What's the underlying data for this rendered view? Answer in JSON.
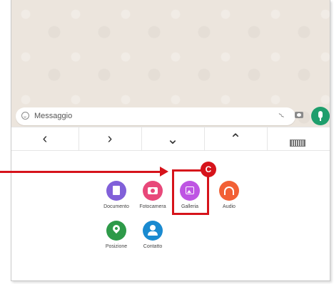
{
  "message_bar": {
    "placeholder": "Messaggio"
  },
  "keys": [
    "‹",
    "›",
    "⌄",
    "⌃"
  ],
  "attachments": [
    {
      "label": "Documento",
      "icon": "document-icon",
      "color": "#8160d9"
    },
    {
      "label": "Fotocamera",
      "icon": "camera-icon",
      "color": "#e8487a"
    },
    {
      "label": "Galleria",
      "icon": "gallery-icon",
      "color": "#be55e3"
    },
    {
      "label": "Audio",
      "icon": "headphones-icon",
      "color": "#f26035"
    },
    {
      "label": "Posizione",
      "icon": "location-pin-icon",
      "color": "#2e9a49"
    },
    {
      "label": "Contatto",
      "icon": "contact-icon",
      "color": "#1a8ad0"
    }
  ],
  "annotation": {
    "badge": "C",
    "color": "#d6131b"
  }
}
